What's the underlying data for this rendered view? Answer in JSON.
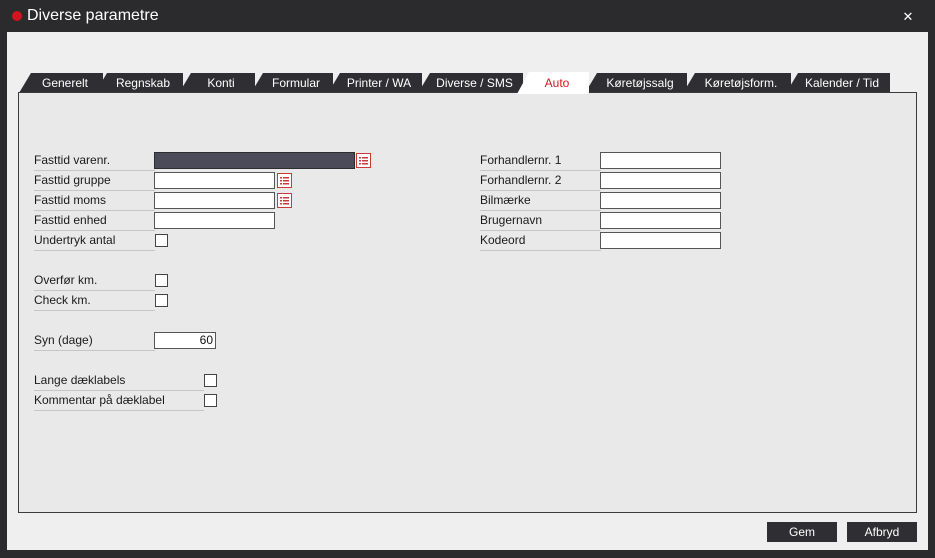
{
  "window": {
    "title": "Diverse parametre",
    "close_glyph": "✕"
  },
  "tabs": [
    {
      "label": "Generelt"
    },
    {
      "label": "Regnskab"
    },
    {
      "label": "Konti"
    },
    {
      "label": "Formular"
    },
    {
      "label": "Printer / WA"
    },
    {
      "label": "Diverse / SMS"
    },
    {
      "label": "Auto",
      "active": true
    },
    {
      "label": "Køretøjssalg"
    },
    {
      "label": "Køretøjsform."
    },
    {
      "label": "Kalender / Tid"
    }
  ],
  "left_fields": [
    {
      "label": "Fasttid varenr.",
      "value": ""
    },
    {
      "label": "Fasttid gruppe",
      "value": ""
    },
    {
      "label": "Fasttid moms",
      "value": ""
    },
    {
      "label": "Fasttid enhed",
      "value": ""
    },
    {
      "label": "Undertryk antal",
      "checked": false
    },
    {
      "label": "Overfør km.",
      "checked": false
    },
    {
      "label": "Check km.",
      "checked": false
    },
    {
      "label": "Syn (dage)",
      "value": "60"
    },
    {
      "label": "Lange dæklabels",
      "checked": false
    },
    {
      "label": "Kommentar på dæklabel",
      "checked": false
    }
  ],
  "right_fields": [
    {
      "label": "Forhandlernr. 1",
      "value": ""
    },
    {
      "label": "Forhandlernr. 2",
      "value": ""
    },
    {
      "label": "Bilmærke",
      "value": ""
    },
    {
      "label": "Brugernavn",
      "value": ""
    },
    {
      "label": "Kodeord",
      "value": ""
    }
  ],
  "buttons": {
    "save": "Gem",
    "cancel": "Afbryd"
  },
  "colors": {
    "accent": "#cf1a1f",
    "titlebar": "#2b2b2e",
    "selected_input": "#4c4b5a"
  },
  "icons": {
    "lookup": "list-lookup-icon",
    "status": "red-dot-icon",
    "close": "close-icon"
  }
}
